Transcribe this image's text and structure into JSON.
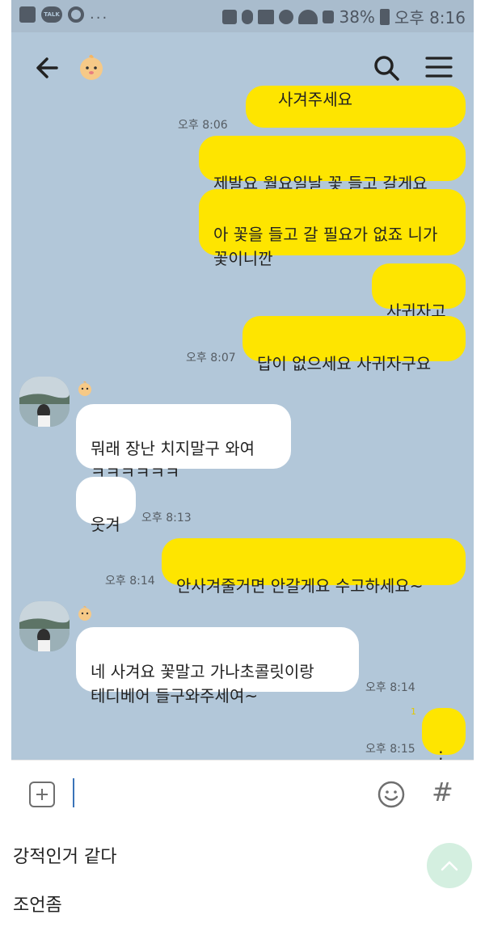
{
  "status_bar": {
    "talk_label": "TALK",
    "dots": "...",
    "battery": "38%",
    "time": "오후 8:16"
  },
  "header": {
    "back_icon": "back-arrow-icon",
    "search_icon": "search-icon",
    "menu_icon": "hamburger-menu-icon"
  },
  "messages": [
    {
      "side": "me",
      "text": "사겨주세요",
      "time": "오후 8:06"
    },
    {
      "side": "me",
      "text": "제발요 월요일날 꽃 들고 갈게요"
    },
    {
      "side": "me",
      "text": "아 꽃을 들고 갈 필요가 없죠 니가\n꽃이니깐"
    },
    {
      "side": "me",
      "text": "사귀자고"
    },
    {
      "side": "me",
      "text": "답이 없으세요 사귀자구요",
      "time": "오후 8:07"
    },
    {
      "side": "them",
      "text": "뭐래 장난 치지말구 와여\nㅋㅋㅋㅋㅋㅋ"
    },
    {
      "side": "them",
      "text": "웃겨",
      "time": "오후 8:13"
    },
    {
      "side": "me",
      "text": "안사겨줄거면 안갈게요 수고하세요~",
      "time": "오후 8:14"
    },
    {
      "side": "them",
      "text": "네 사겨요 꽃말고 가나초콜릿이랑\n테디베어 들구와주세여~",
      "time": "오후 8:14"
    },
    {
      "side": "me",
      "text": ";",
      "time": "오후 8:15",
      "unread": "1"
    }
  ],
  "input": {
    "plus_icon": "plus-attach-icon",
    "emoji_icon": "emoji-icon",
    "hash_label": "#"
  },
  "comments": [
    "강적인거 같다",
    "조언좀"
  ],
  "colors": {
    "chat_background": "#b2c7d9",
    "my_bubble": "#fee500",
    "their_bubble": "#ffffff"
  }
}
